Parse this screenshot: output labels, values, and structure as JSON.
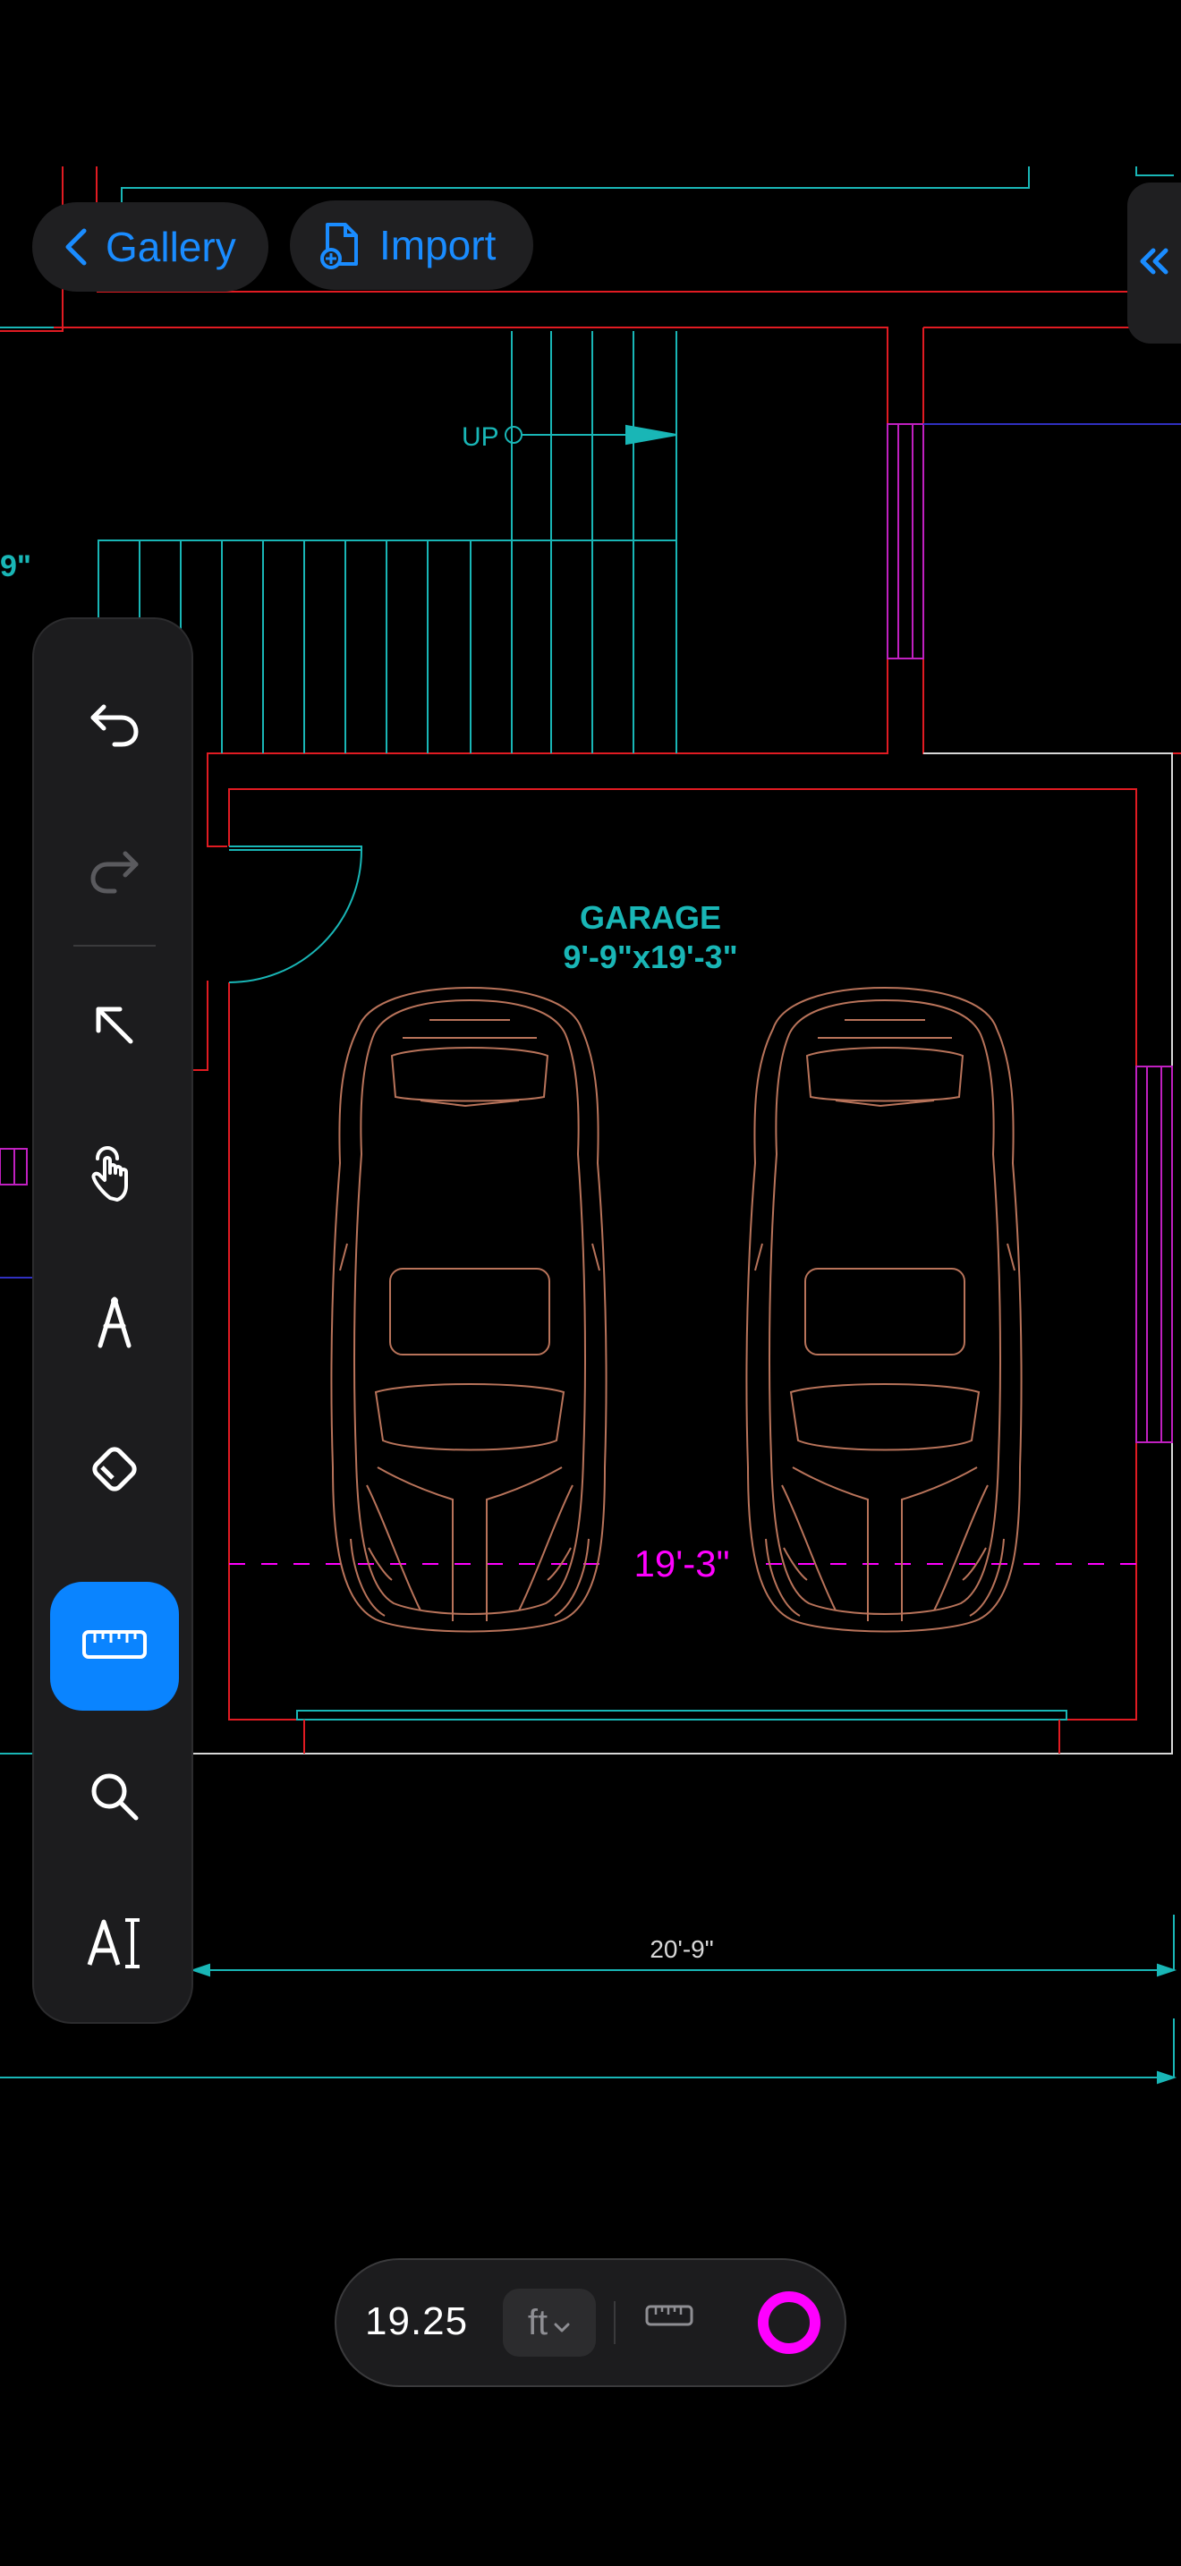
{
  "nav": {
    "gallery_label": "Gallery",
    "import_label": "Import"
  },
  "drawing": {
    "room_name": "GARAGE",
    "room_size": "9'-9\"x19'-3\"",
    "stair_label": "UP",
    "partial_dim_label": "9\"",
    "measurement_label": "19'-3\"",
    "bottom_dim_label": "20'-9\""
  },
  "toolbar": {
    "tools": [
      {
        "name": "undo",
        "icon": "undo-icon",
        "enabled": true
      },
      {
        "name": "redo",
        "icon": "redo-icon",
        "enabled": false
      },
      {
        "name": "select",
        "icon": "arrow-up-left-icon"
      },
      {
        "name": "pan",
        "icon": "hand-tap-icon"
      },
      {
        "name": "draw",
        "icon": "compass-pen-icon"
      },
      {
        "name": "erase",
        "icon": "eraser-icon"
      },
      {
        "name": "measure",
        "icon": "ruler-icon",
        "active": true
      },
      {
        "name": "zoom",
        "icon": "magnifier-icon"
      },
      {
        "name": "text",
        "icon": "text-cursor-icon"
      }
    ]
  },
  "measure_bar": {
    "value": "19.25",
    "unit": "ft",
    "accent": "#ff00ff"
  },
  "colors": {
    "wall": "#e11b22",
    "cyan": "#19b6b6",
    "magenta": "#ff00ff",
    "car": "#b8735a",
    "accent": "#0a84ff"
  }
}
